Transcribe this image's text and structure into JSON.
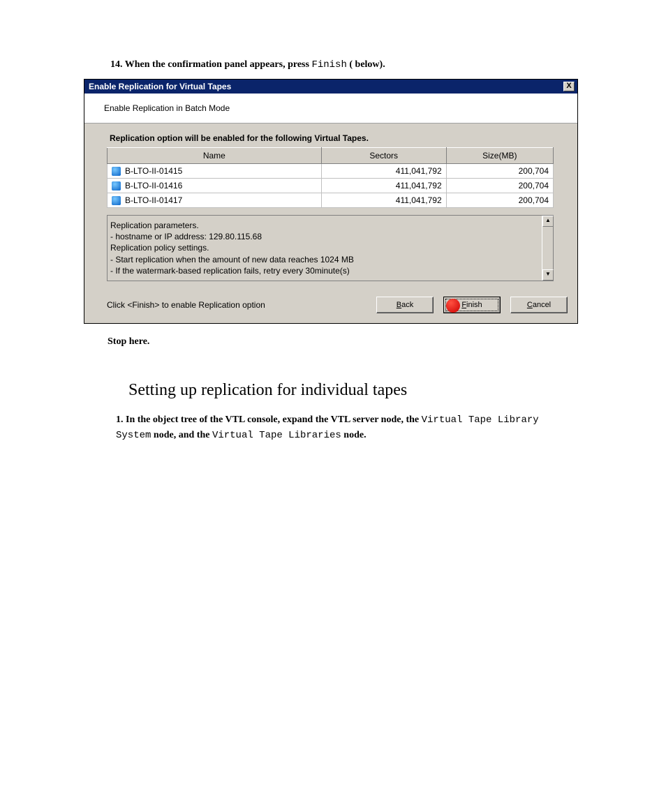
{
  "step14": {
    "number": "14.",
    "prefix": "When the confirmation panel appears, press ",
    "mono": "Finish",
    "suffix": " (    below)."
  },
  "dialog": {
    "title": "Enable Replication for Virtual Tapes",
    "close": "X",
    "subtitle": "Enable Replication in Batch Mode",
    "optionText": "Replication option will be enabled for the following Virtual Tapes.",
    "columns": {
      "name": "Name",
      "sectors": "Sectors",
      "size": "Size(MB)"
    },
    "rows": [
      {
        "name": "B-LTO-II-01415",
        "sectors": "411,041,792",
        "size": "200,704"
      },
      {
        "name": "B-LTO-II-01416",
        "sectors": "411,041,792",
        "size": "200,704"
      },
      {
        "name": "B-LTO-II-01417",
        "sectors": "411,041,792",
        "size": "200,704"
      }
    ],
    "params": {
      "l1": "Replication parameters.",
      "l2": "- hostname or IP address: 129.80.115.68",
      "l3": "Replication policy settings.",
      "l4": "- Start replication when the amount of new data reaches 1024 MB",
      "l5": "- If the watermark-based replication fails, retry every 30minute(s)"
    },
    "hint": "Click <Finish> to enable Replication option",
    "buttons": {
      "back": "Back",
      "finish": "Finish",
      "cancel": "Cancel"
    },
    "underline": {
      "back": "B",
      "finish": "F",
      "cancel": "C"
    }
  },
  "stopHere": "Stop here.",
  "sectionHeading": "Setting up replication for individual tapes",
  "step1": {
    "number": "1.",
    "p1": "In the object tree of the VTL console, expand the VTL server node, the ",
    "mono1": "Virtual Tape Library System",
    "p2": " node, and the ",
    "mono2": "Virtual Tape Libraries",
    "p3": " node."
  }
}
